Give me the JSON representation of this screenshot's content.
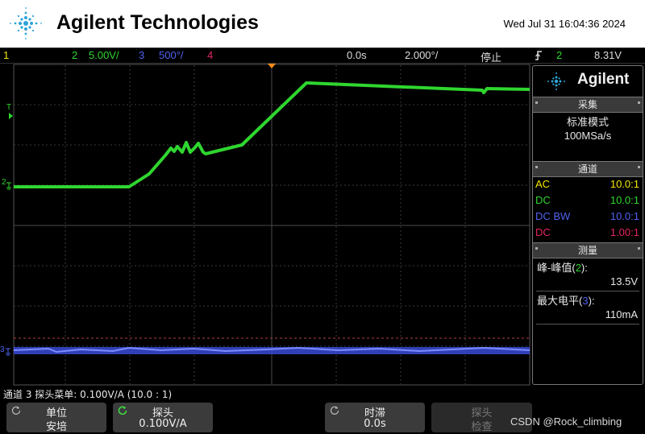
{
  "header": {
    "brand": "Agilent Technologies",
    "datetime": "Wed Jul 31 16:04:36 2024"
  },
  "status_bar": {
    "ch1": "1",
    "ch2": "2",
    "ch2_scale": "5.00V/",
    "ch3": "3",
    "ch3_scale": "500°/",
    "ch4": "4",
    "delay": "0.0s",
    "timebase": "2.000°/",
    "run_state": "停止",
    "trig_icon": "trigger-edge-icon",
    "trig_channel": "2",
    "trig_level": "8.31V"
  },
  "colors": {
    "ch1": "#f2e600",
    "ch2": "#2fd62f",
    "ch3": "#4f62f0",
    "ch4": "#e6255e",
    "trigger_marker": "#ff8c1a"
  },
  "screen": {
    "trig_marker_label": "T",
    "ch2_marker_label": "2",
    "ch3_marker_label": "3"
  },
  "side_panel": {
    "brand": "Agilent",
    "acquire": {
      "title": "采集",
      "mode": "标准模式",
      "rate": "100MSa/s"
    },
    "channels": {
      "title": "通道",
      "rows": [
        {
          "coupling": "AC",
          "ratio": "10.0:1",
          "color": "#f2e600"
        },
        {
          "coupling": "DC",
          "ratio": "10.0:1",
          "color": "#2fd62f"
        },
        {
          "coupling": "DC BW",
          "ratio": "10.0:1",
          "color": "#4f62f0"
        },
        {
          "coupling": "DC",
          "ratio": "1.00:1",
          "color": "#e6255e"
        }
      ]
    },
    "measure": {
      "title": "测量",
      "m1_label": "峰-峰值",
      "m1_channel": "2",
      "m1_value": "13.5V",
      "m2_label": "最大电平",
      "m2_channel": "3",
      "m2_value": "110mA",
      "paren_open": "(",
      "paren_close_colon": "):"
    }
  },
  "status_line": "通道 3 探头菜单: 0.100V/A (10.0 : 1)",
  "softkeys": {
    "unit": {
      "label": "单位",
      "value": "安培"
    },
    "probe": {
      "label": "探头",
      "value": "0.100V/A"
    },
    "skew": {
      "label": "时滞",
      "value": "0.0s"
    },
    "probe_check": {
      "label": "探头",
      "value": "检查"
    }
  },
  "watermark": "CSDN @Rock_climbing"
}
